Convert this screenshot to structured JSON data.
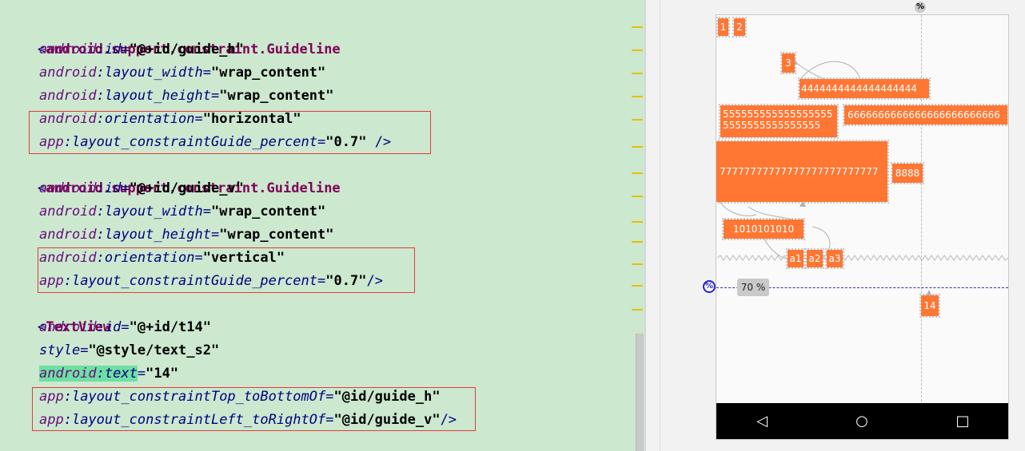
{
  "editor": {
    "blocks": [
      {
        "tag": "android.support.constraint.Guideline",
        "attrs": [
          {
            "ns": "android",
            "name": "id",
            "value": "\"@+id/guide_h\"",
            "end": ""
          },
          {
            "ns": "android",
            "name": "layout_width",
            "value": "\"wrap_content\"",
            "end": ""
          },
          {
            "ns": "android",
            "name": "layout_height",
            "value": "\"wrap_content\"",
            "end": ""
          },
          {
            "ns": "android",
            "name": "orientation",
            "value": "\"horizontal\"",
            "end": ""
          },
          {
            "ns": "app",
            "name": "layout_constraintGuide_percent",
            "value": "\"0.7\"",
            "end": " />"
          }
        ]
      },
      {
        "tag": "android.support.constraint.Guideline",
        "attrs": [
          {
            "ns": "android",
            "name": "id",
            "value": "\"@+id/guide_v\"",
            "end": ""
          },
          {
            "ns": "android",
            "name": "layout_width",
            "value": "\"wrap_content\"",
            "end": ""
          },
          {
            "ns": "android",
            "name": "layout_height",
            "value": "\"wrap_content\"",
            "end": ""
          },
          {
            "ns": "android",
            "name": "orientation",
            "value": "\"vertical\"",
            "end": ""
          },
          {
            "ns": "app",
            "name": "layout_constraintGuide_percent",
            "value": "\"0.7\"",
            "end": "/>"
          }
        ]
      },
      {
        "tag": "TextView",
        "attrs": [
          {
            "ns": "android",
            "name": "id",
            "value": "\"@+id/t14\"",
            "end": ""
          },
          {
            "ns": "",
            "name": "style",
            "value": "\"@style/text_s2\"",
            "end": ""
          },
          {
            "ns": "android",
            "name": "text",
            "value": "\"14\"",
            "end": "",
            "highlight": true
          },
          {
            "ns": "app",
            "name": "layout_constraintTop_toBottomOf",
            "value": "\"@id/guide_h\"",
            "end": ""
          },
          {
            "ns": "app",
            "name": "layout_constraintLeft_toRightOf",
            "value": "\"@id/guide_v\"",
            "end": "/>"
          }
        ]
      }
    ]
  },
  "preview": {
    "percent_symbol": "%",
    "guide_percent_label": "70 %",
    "views": {
      "v1": "1",
      "v2": "2",
      "v3": "3",
      "v4": "4444444444444444444",
      "v5_line1": "555555555555555555",
      "v5_line2": "5555555555555555",
      "v6": "6666666666666666666666666",
      "v7": "77777777777777777777777777",
      "v8": "8888",
      "v10": "1010101010",
      "a1": "a1",
      "a2": "a2",
      "a3": "a3",
      "t14": "14"
    },
    "nav": {
      "back": "◁",
      "home": "○",
      "recents": "□"
    }
  },
  "colors": {
    "editor_bg": "#cce8cf",
    "view_fill": "#ff7733",
    "guideline_blue": "#2d2db8",
    "selection_red": "#e23b3b"
  }
}
